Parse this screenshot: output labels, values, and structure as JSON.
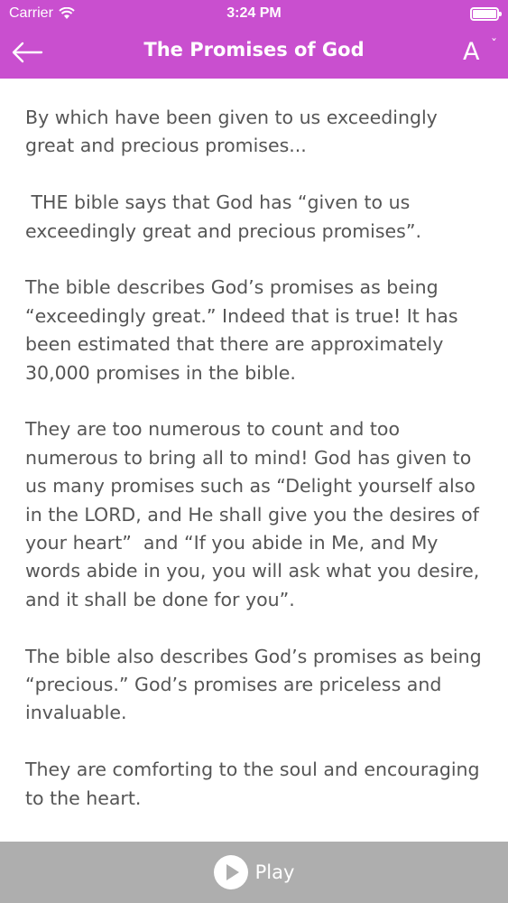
{
  "status_bar": {
    "carrier": "Carrier",
    "time": "3:24 PM"
  },
  "nav": {
    "title": "The Promises of God",
    "font_size_letter": "A",
    "font_size_caret": "ˇ"
  },
  "content": {
    "paragraphs": [
      "By which have been given to us exceedingly great and precious promises...",
      " THE bible says that God has “given to us exceedingly great and precious promises”.",
      "The bible describes God’s promises as being “exceedingly great.” Indeed that is true! It has been estimated that there are approximately 30,000 promises in the bible.",
      "They are too numerous to count and too numerous to bring all to mind! God has given to us many promises such as “Delight yourself also in the LORD, and He shall give you the desires of your heart”  and “If you abide in Me, and My words abide in you, you will ask what you desire, and it shall be done for you”.",
      "The bible also describes God’s promises as being “precious.” God’s promises are priceless and invaluable.",
      "They are comforting to the soul and encouraging to the heart."
    ]
  },
  "player": {
    "play_label": "Play"
  },
  "colors": {
    "header": "#c94fcf",
    "body_text": "#555555",
    "player_bar": "#aeaeae"
  },
  "icons": {
    "back": "back-arrow-icon",
    "wifi": "wifi-icon",
    "battery": "battery-icon",
    "play": "play-icon"
  }
}
